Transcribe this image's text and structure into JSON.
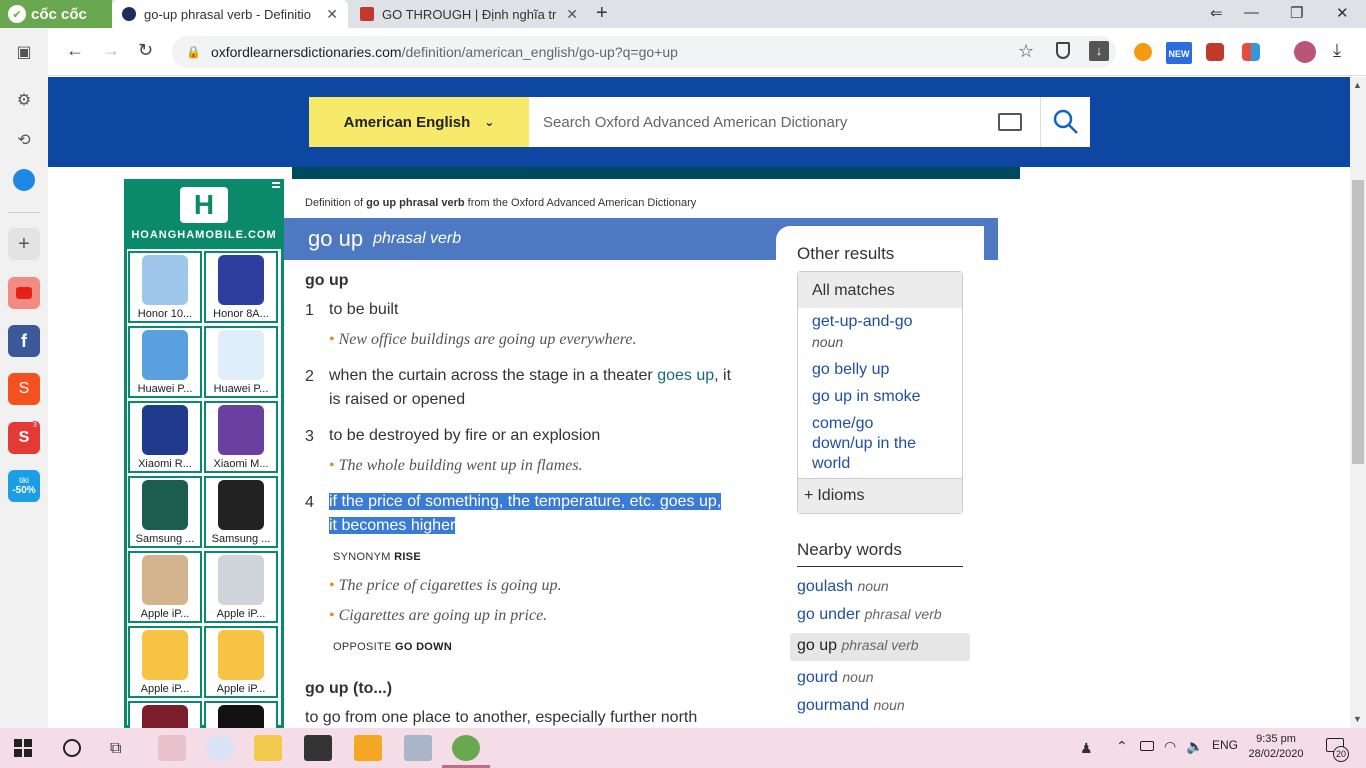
{
  "browser": {
    "brand": "cốc cốc",
    "tabs": [
      {
        "title": "go-up phrasal verb - Definitio",
        "active": true
      },
      {
        "title": "GO THROUGH | Định nghĩa tr",
        "active": false
      }
    ],
    "url_domain": "oxfordlearnersdictionaries.com",
    "url_path": "/definition/american_english/go-up?q=go+up",
    "new_badge": "NEW",
    "notif_count": "3",
    "tiki_label": "tiki",
    "tiki_discount": "-50%"
  },
  "site": {
    "language": "American English",
    "search_placeholder": "Search Oxford Advanced American Dictionary",
    "breadcrumb_prefix": "Definition of",
    "breadcrumb_term": "go up phrasal verb",
    "breadcrumb_suffix": "from the Oxford Advanced American Dictionary"
  },
  "ad": {
    "site": "HOANGHAMOBILE.COM",
    "logo": "H",
    "products": [
      {
        "name": "Honor 10..."
      },
      {
        "name": "Honor 8A..."
      },
      {
        "name": "Huawei P..."
      },
      {
        "name": "Huawei P..."
      },
      {
        "name": "Xiaomi R..."
      },
      {
        "name": "Xiaomi M..."
      },
      {
        "name": "Samsung ..."
      },
      {
        "name": "Samsung ..."
      },
      {
        "name": "Apple iP..."
      },
      {
        "name": "Apple iP..."
      },
      {
        "name": "Apple iP..."
      },
      {
        "name": "Apple iP..."
      },
      {
        "name": ""
      },
      {
        "name": ""
      }
    ]
  },
  "entry": {
    "headword": "go up",
    "pos": "phrasal verb",
    "sense_group": "go up",
    "senses": [
      {
        "num": "1",
        "def": "to be built",
        "examples": [
          "New office buildings are going up everywhere."
        ]
      },
      {
        "num": "2",
        "def_a": "when the curtain across the stage in a theater",
        "def_link": "goes up",
        "def_b": ", it",
        "def_c": "is raised or opened"
      },
      {
        "num": "3",
        "def": "to be destroyed by fire or an explosion",
        "examples": [
          "The whole building went up in flames."
        ]
      },
      {
        "num": "4",
        "def_line1": "if the price of something, the temperature, etc. goes up,",
        "def_line2": "it becomes higher",
        "synonym_label": "SYNONYM",
        "synonym": "RISE",
        "examples": [
          "The price of cigarettes is going up.",
          "Cigarettes are going up in price."
        ],
        "opposite_label": "OPPOSITE",
        "opposite": "GO DOWN"
      }
    ],
    "next_group": "go up (to...)",
    "next_def": "to go from one place to another, especially further north"
  },
  "sidebar": {
    "other_results": "Other results",
    "all_matches": "All matches",
    "matches": [
      {
        "text": "get-up-and-go",
        "pos": "noun"
      },
      {
        "text": "go belly up"
      },
      {
        "text": "go up in smoke"
      },
      {
        "text_1": "come/go",
        "text_2": "down/up in the",
        "text_3": "world"
      }
    ],
    "idioms": "Idioms",
    "nearby_words": "Nearby words",
    "nearby": [
      {
        "word": "goulash",
        "pos": "noun"
      },
      {
        "word": "go under",
        "pos": "phrasal verb"
      },
      {
        "word": "go up",
        "pos": "phrasal verb",
        "selected": true
      },
      {
        "word": "gourd",
        "pos": "noun"
      },
      {
        "word": "gourmand",
        "pos": "noun"
      }
    ]
  },
  "taskbar": {
    "language": "ENG",
    "time": "9:35 pm",
    "date": "28/02/2020",
    "notifications": "20"
  },
  "colors": {
    "header_blue": "#0d47a1",
    "entry_blue": "#4c79c2",
    "language_yellow": "#f7e96a",
    "ad_green": "#0a8a6a",
    "highlight": "#3a7bd5",
    "bullet_orange": "#e48a2f"
  }
}
